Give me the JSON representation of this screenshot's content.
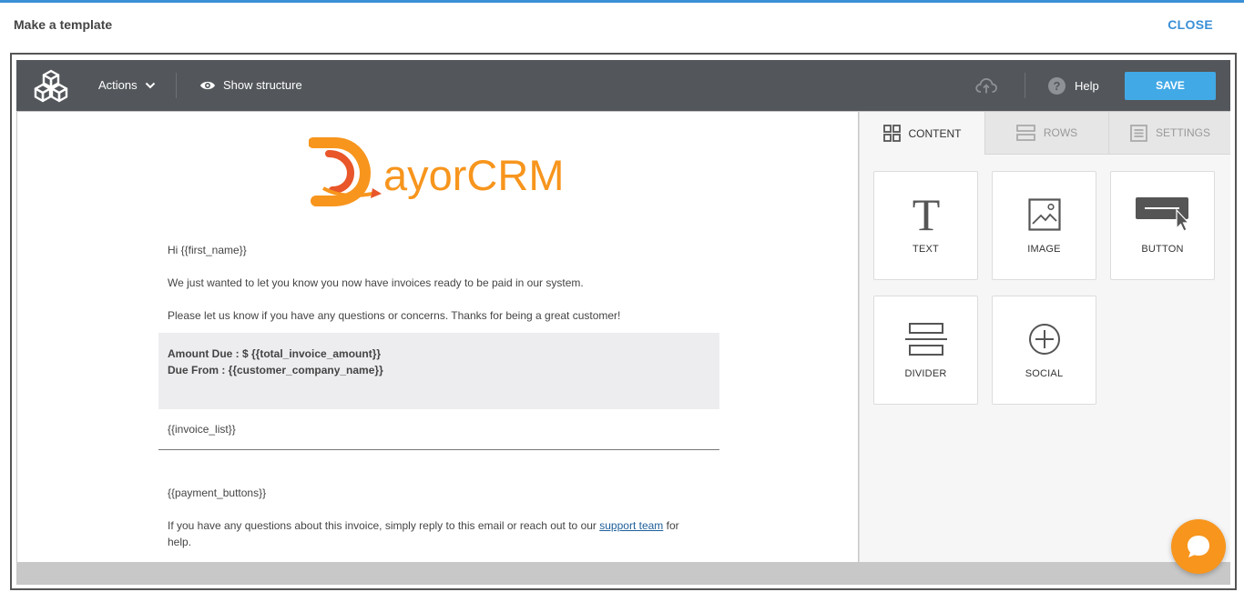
{
  "dialog": {
    "title": "Make a template",
    "close_label": "CLOSE"
  },
  "toolbar": {
    "actions_label": "Actions",
    "show_structure_label": "Show structure",
    "help_label": "Help",
    "save_label": "SAVE"
  },
  "email": {
    "brand_logo_text": "ayorCRM",
    "greeting": "Hi {{first_name}}",
    "line1": "We just wanted to let you know you now have invoices ready to be paid in our system.",
    "line2": "Please let us know if you have any questions or concerns. Thanks for being a great customer!",
    "amount_due": "Amount Due : $ {{total_invoice_amount}}",
    "due_from": "Due From : {{customer_company_name}}",
    "invoice_list": "{{invoice_list}}",
    "payment_buttons": "{{payment_buttons}}",
    "footer_before": "If you have any questions about this invoice, simply reply to this email or reach out to our ",
    "footer_link": "support team",
    "footer_after": " for",
    "footer_line2": "help."
  },
  "sidebar": {
    "tabs": [
      {
        "label": "CONTENT",
        "icon": "grid-icon",
        "active": true
      },
      {
        "label": "ROWS",
        "icon": "rows-icon",
        "active": false
      },
      {
        "label": "SETTINGS",
        "icon": "settings-list-icon",
        "active": false
      }
    ],
    "tiles": [
      {
        "label": "TEXT",
        "icon": "text-icon"
      },
      {
        "label": "IMAGE",
        "icon": "image-icon"
      },
      {
        "label": "BUTTON",
        "icon": "button-icon"
      },
      {
        "label": "DIVIDER",
        "icon": "divider-icon"
      },
      {
        "label": "SOCIAL",
        "icon": "social-plus-icon"
      }
    ]
  },
  "colors": {
    "accent": "#3a8fd6",
    "toolbar": "#53575b",
    "save": "#41a9e6",
    "brand_orange": "#f7951d",
    "brand_red": "#e8562a",
    "chat": "#f7951d"
  }
}
